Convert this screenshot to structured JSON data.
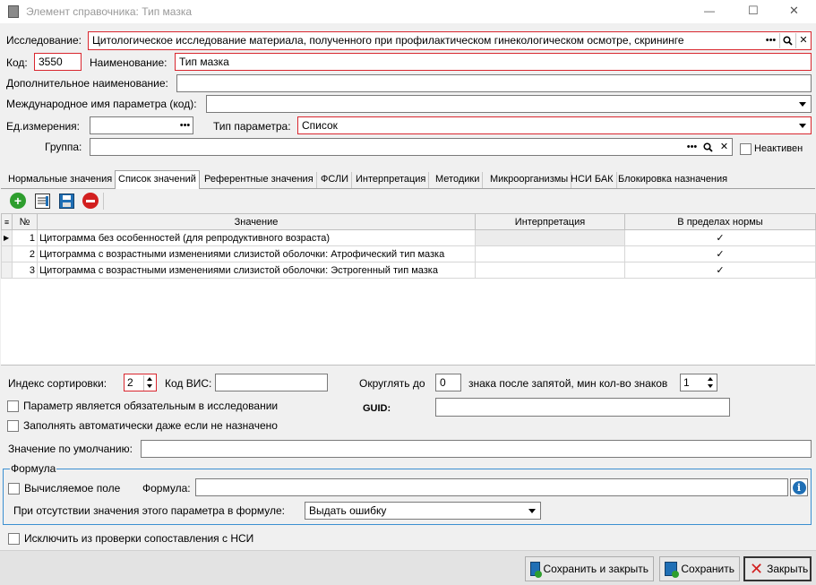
{
  "window": {
    "title": "Элемент справочника: Тип мазка",
    "minimize": "—",
    "maximize": "☐",
    "close": "✕"
  },
  "form": {
    "study_label": "Исследование:",
    "study_value": "Цитологическое исследование материала, полученного при профилактическом гинекологическом осмотре, скрининге",
    "code_label": "Код:",
    "code_value": "3550",
    "name_label": "Наименование:",
    "name_value": "Тип мазка",
    "extra_name_label": "Дополнительное наименование:",
    "extra_name_value": "",
    "intl_name_label": "Международное имя параметра (код):",
    "intl_name_value": "",
    "unit_label": "Ед.измерения:",
    "unit_value": "",
    "param_type_label": "Тип параметра:",
    "param_type_value": "Список",
    "group_label": "Группа:",
    "group_value": "",
    "inactive_label": "Неактивен"
  },
  "tabs": [
    {
      "label": "Нормальные значения",
      "active": false
    },
    {
      "label": "Список значений",
      "active": true
    },
    {
      "label": "Референтные значения",
      "active": false
    },
    {
      "label": "ФСЛИ",
      "active": false
    },
    {
      "label": "Интерпретация",
      "active": false
    },
    {
      "label": "Методики",
      "active": false
    },
    {
      "label": "Микроорганизмы",
      "active": false
    },
    {
      "label": "НСИ БАК",
      "active": false
    },
    {
      "label": "Блокировка назначения",
      "active": false
    }
  ],
  "grid": {
    "columns": [
      "№",
      "Значение",
      "Интерпретация",
      "В пределах нормы"
    ],
    "rows": [
      {
        "num": "1",
        "value": "Цитограмма без особенностей (для репродуктивного возраста)",
        "interp": "",
        "in_norm": true
      },
      {
        "num": "2",
        "value": "Цитограмма с возрастными изменениями слизистой оболочки: Атрофический тип мазка",
        "interp": "",
        "in_norm": true
      },
      {
        "num": "3",
        "value": "Цитограмма с возрастными изменениями слизистой оболочки: Эстрогенный тип мазка",
        "interp": "",
        "in_norm": true
      }
    ]
  },
  "lower": {
    "sort_label": "Индекс сортировки:",
    "sort_value": "2",
    "vis_code_label": "Код ВИС:",
    "vis_code_value": "",
    "round_label": "Округлять до",
    "round_value": "0",
    "decimals_label": "знака после запятой, мин кол-во знаков",
    "decimals_value": "1",
    "mandatory_label": "Параметр является обязательным в исследовании",
    "autofill_label": "Заполнять автоматически даже если не назначено",
    "guid_label": "GUID:",
    "guid_value": "",
    "default_label": "Значение по умолчанию:",
    "default_value": ""
  },
  "formula": {
    "group_title": "Формула",
    "computed_label": "Вычисляемое поле",
    "formula_label": "Формула:",
    "formula_value": "",
    "missing_label": "При отсутствии значения этого параметра в формуле:",
    "missing_value": "Выдать ошибку"
  },
  "exclude_label": "Исключить из проверки сопоставления с НСИ",
  "buttons": {
    "save_close": "Сохранить и закрыть",
    "save": "Сохранить",
    "close": "Закрыть"
  },
  "colors": {
    "required_border": "#d9262e",
    "add_icon": "#2e9e2e",
    "delete_icon": "#d21f1f",
    "save_icon": "#1f6fb5"
  }
}
